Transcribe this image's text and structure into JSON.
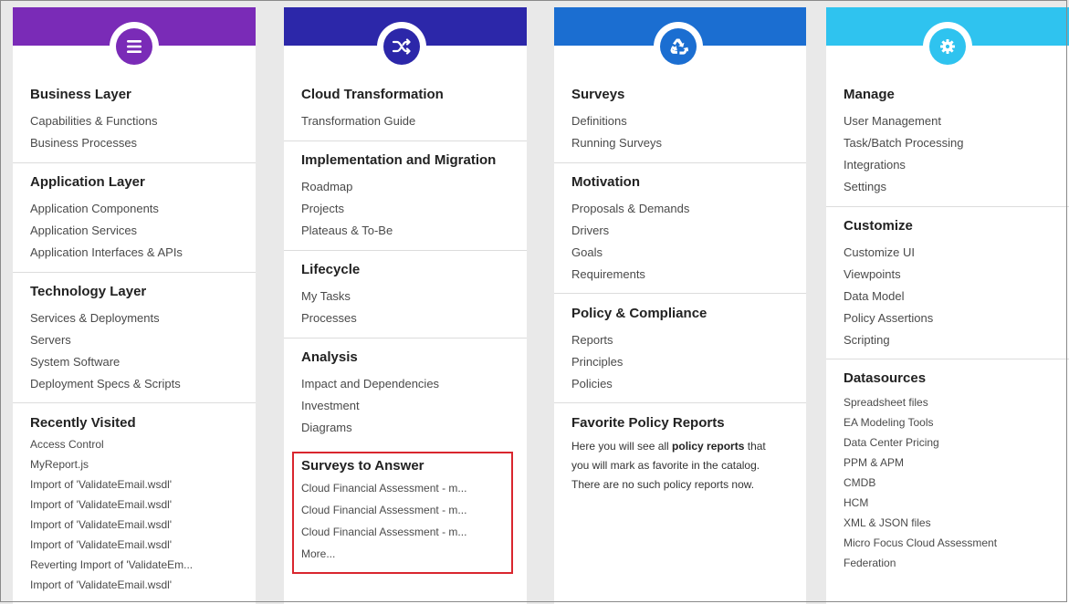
{
  "colors": {
    "band1": "#7a2bb7",
    "band2": "#2c27a9",
    "band3": "#1b6ed1",
    "band4": "#2fc3ef",
    "highlight": "#d9262e"
  },
  "columns": [
    {
      "icon": "menu-icon",
      "sections": [
        {
          "heading": "Business Layer",
          "items": [
            "Capabilities & Functions",
            "Business Processes"
          ]
        },
        {
          "heading": "Application Layer",
          "items": [
            "Application Components",
            "Application Services",
            "Application Interfaces & APIs"
          ]
        },
        {
          "heading": "Technology Layer",
          "items": [
            "Services & Deployments",
            "Servers",
            "System Software",
            "Deployment Specs & Scripts"
          ]
        },
        {
          "heading": "Recently Visited",
          "items": [
            "Access Control",
            "MyReport.js",
            "Import of 'ValidateEmail.wsdl'",
            "Import of 'ValidateEmail.wsdl'",
            "Import of 'ValidateEmail.wsdl'",
            "Import of 'ValidateEmail.wsdl'",
            "Reverting Import of 'ValidateEm...",
            "Import of 'ValidateEmail.wsdl'"
          ]
        }
      ]
    },
    {
      "icon": "shuffle-icon",
      "sections": [
        {
          "heading": "Cloud Transformation",
          "items": [
            "Transformation Guide"
          ]
        },
        {
          "heading": "Implementation and Migration",
          "items": [
            "Roadmap",
            "Projects",
            "Plateaus & To-Be"
          ]
        },
        {
          "heading": "Lifecycle",
          "items": [
            "My Tasks",
            "Processes"
          ]
        },
        {
          "heading": "Analysis",
          "items": [
            "Impact and Dependencies",
            "Investment",
            "Diagrams"
          ]
        },
        {
          "heading": "Surveys to Answer",
          "items": [
            "Cloud Financial Assessment - m...",
            "Cloud Financial Assessment - m...",
            "Cloud Financial Assessment - m...",
            "More..."
          ]
        }
      ]
    },
    {
      "icon": "recycle-icon",
      "sections": [
        {
          "heading": "Surveys",
          "items": [
            "Definitions",
            "Running Surveys"
          ]
        },
        {
          "heading": "Motivation",
          "items": [
            "Proposals & Demands",
            "Drivers",
            "Goals",
            "Requirements"
          ]
        },
        {
          "heading": "Policy & Compliance",
          "items": [
            "Reports",
            "Principles",
            "Policies"
          ]
        },
        {
          "heading": "Favorite Policy Reports",
          "text_before": "Here you will see all ",
          "text_bold": "policy reports",
          "text_after": " that you will mark as favorite in the catalog. There are no such policy reports now."
        }
      ]
    },
    {
      "icon": "gear-icon",
      "sections": [
        {
          "heading": "Manage",
          "items": [
            "User Management",
            "Task/Batch Processing",
            "Integrations",
            "Settings"
          ]
        },
        {
          "heading": "Customize",
          "items": [
            "Customize UI",
            "Viewpoints",
            "Data Model",
            "Policy Assertions",
            "Scripting"
          ]
        },
        {
          "heading": "Datasources",
          "items": [
            "Spreadsheet files",
            "EA Modeling Tools",
            "Data Center Pricing",
            "PPM & APM",
            "CMDB",
            "HCM",
            "XML & JSON files",
            "Micro Focus Cloud Assessment",
            "Federation"
          ]
        }
      ]
    }
  ]
}
